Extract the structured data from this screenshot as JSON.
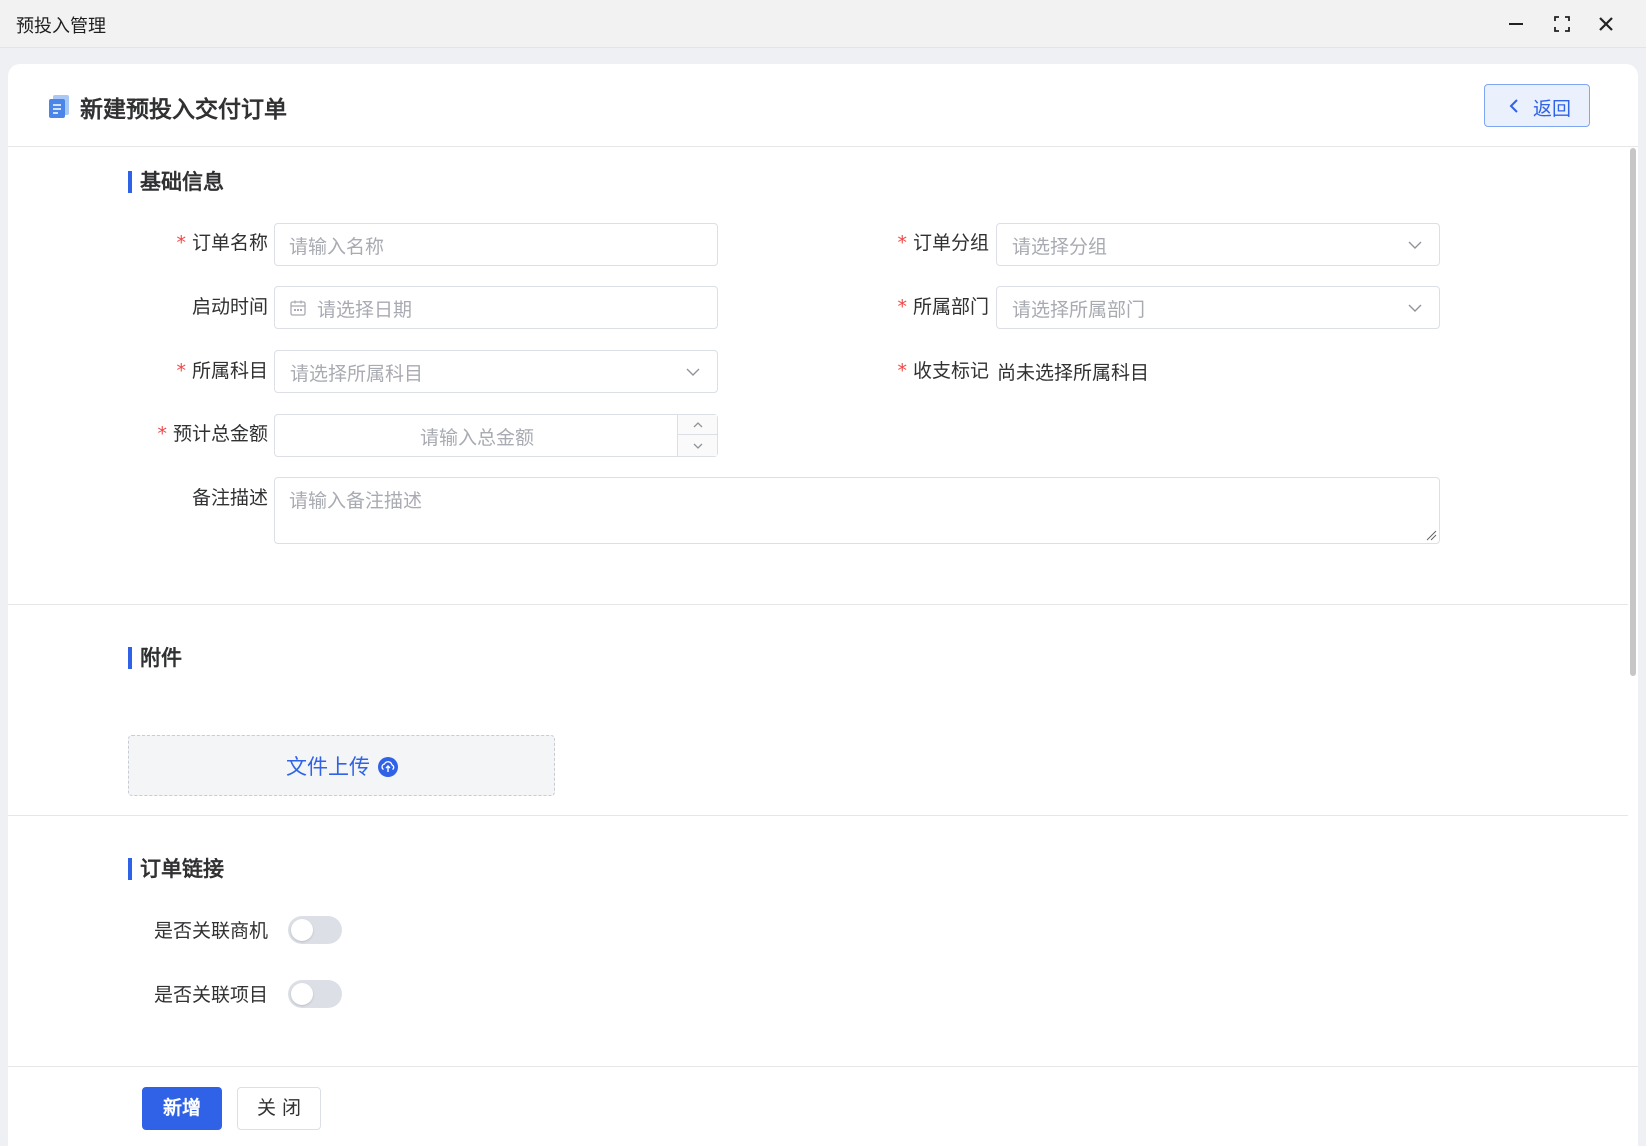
{
  "window": {
    "title": "预投入管理"
  },
  "header": {
    "title": "新建预投入交付订单",
    "back_label": "返回"
  },
  "sections": {
    "basic": "基础信息",
    "attachment": "附件",
    "order_link": "订单链接"
  },
  "form": {
    "order_name": {
      "label": "订单名称",
      "placeholder": "请输入名称",
      "required": true
    },
    "order_group": {
      "label": "订单分组",
      "placeholder": "请选择分组",
      "required": true
    },
    "start_time": {
      "label": "启动时间",
      "placeholder": "请选择日期",
      "required": false
    },
    "department": {
      "label": "所属部门",
      "placeholder": "请选择所属部门",
      "required": true
    },
    "subject": {
      "label": "所属科目",
      "placeholder": "请选择所属科目",
      "required": true
    },
    "income_expense": {
      "label": "收支标记",
      "value": "尚未选择所属科目",
      "required": true
    },
    "total_amount": {
      "label": "预计总金额",
      "placeholder": "请输入总金额",
      "required": true
    },
    "remark": {
      "label": "备注描述",
      "placeholder": "请输入备注描述",
      "required": false
    }
  },
  "attachment": {
    "upload_label": "文件上传"
  },
  "order_link": {
    "link_opportunity": {
      "label": "是否关联商机",
      "on": false
    },
    "link_project": {
      "label": "是否关联项目",
      "on": false
    }
  },
  "footer": {
    "submit_label": "新增",
    "close_label": "关 闭"
  },
  "required_mark": "*",
  "colors": {
    "accent": "#2f62e7",
    "required": "#f04848",
    "placeholder": "#a8abb2"
  }
}
